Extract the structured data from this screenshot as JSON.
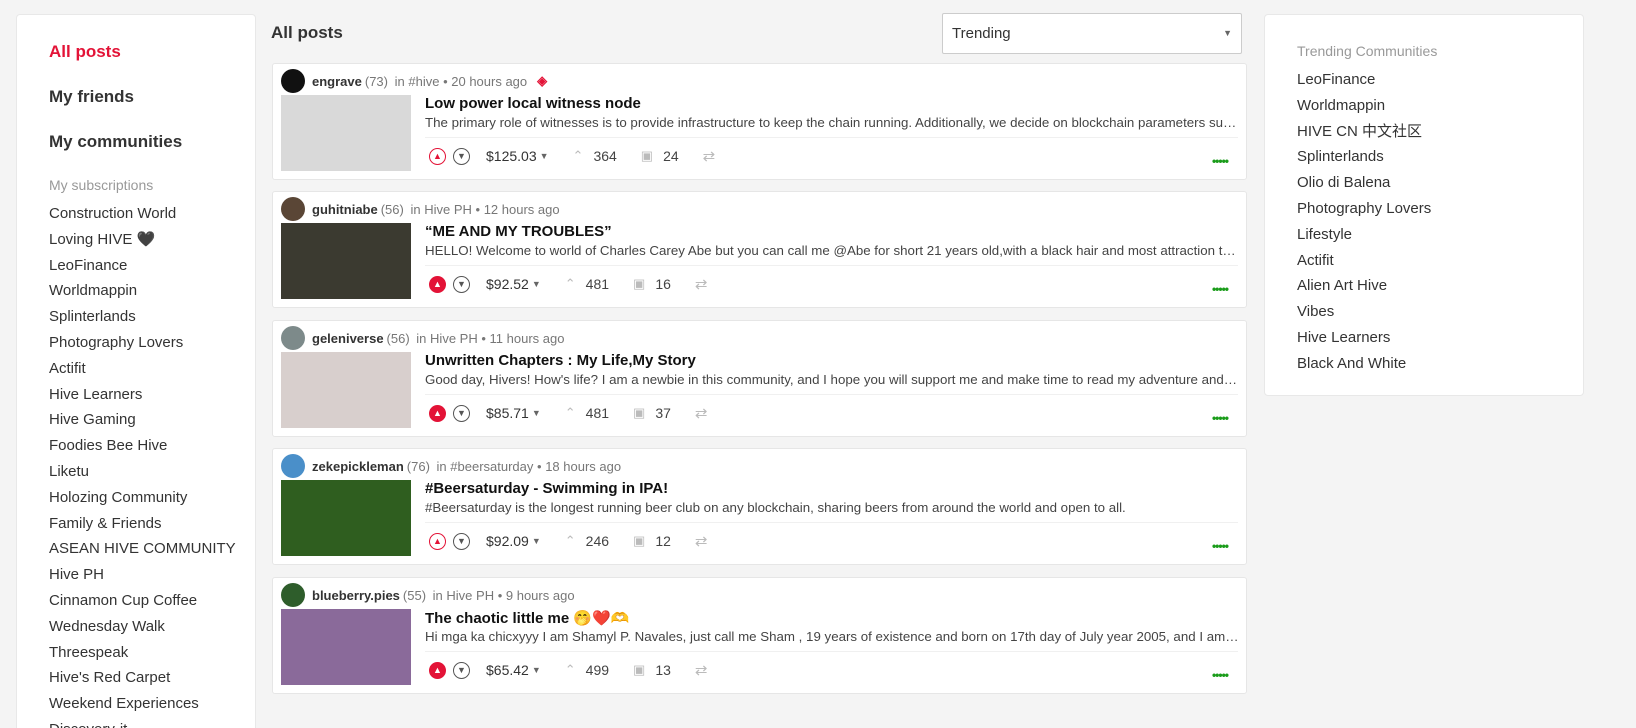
{
  "sidebar": {
    "nav": [
      "All posts",
      "My friends",
      "My communities"
    ],
    "subscriptions_heading": "My subscriptions",
    "subscriptions": [
      "Construction World",
      "Loving HIVE 🖤",
      "LeoFinance",
      "Worldmappin",
      "Splinterlands",
      "Photography Lovers",
      "Actifit",
      "Hive Learners",
      "Hive Gaming",
      "Foodies Bee Hive",
      "Liketu",
      "Holozing Community",
      "Family & Friends",
      "ASEAN HIVE COMMUNITY",
      "Hive PH",
      "Cinnamon Cup Coffee",
      "Wednesday Walk",
      "Threespeak",
      "Hive's Red Carpet",
      "Weekend Experiences",
      "Discovery-it"
    ]
  },
  "header": {
    "title": "All posts",
    "sort_value": "Trending"
  },
  "trending": {
    "heading": "Trending Communities",
    "items": [
      "LeoFinance",
      "Worldmappin",
      "HIVE CN 中文社区",
      "Splinterlands",
      "Olio di Balena",
      "Photography Lovers",
      "Lifestyle",
      "Actifit",
      "Alien Art Hive",
      "Vibes",
      "Hive Learners",
      "Black And White"
    ]
  },
  "posts": [
    {
      "author": "engrave",
      "rep": "(73)",
      "in": "in",
      "community": "#hive",
      "time": "• 20 hours ago",
      "title": "Low power local witness node",
      "summary": "The primary role of witnesses is to provide infrastructure to keep the chain running. Additionally, we decide on blockchain parameters such as interest rates and fees.",
      "payout": "$125.03",
      "votes": "364",
      "comments": "24",
      "voted": false,
      "avatar_color": "#111111",
      "thumb_color": "#d9d9d9"
    },
    {
      "author": "guhitniabe",
      "rep": "(56)",
      "in": "in",
      "community": "Hive PH",
      "time": "• 12 hours ago",
      "title": "“ME AND MY TROUBLES”",
      "summary": "HELLO! Welcome to world of Charles Carey Abe but you can call me @Abe for short 21 years old,with a black hair and most attraction to all.",
      "payout": "$92.52",
      "votes": "481",
      "comments": "16",
      "voted": true,
      "avatar_color": "#5a4636",
      "thumb_color": "#3b3a30"
    },
    {
      "author": "geleniverse",
      "rep": "(56)",
      "in": "in",
      "community": "Hive PH",
      "time": "• 11 hours ago",
      "title": "Unwritten Chapters : My Life,My Story",
      "summary": "Good day, Hivers! How's life? I am a newbie in this community, and I hope you will support me and make time to read my adventure and stories.",
      "payout": "$85.71",
      "votes": "481",
      "comments": "37",
      "voted": true,
      "avatar_color": "#7d8a8a",
      "thumb_color": "#d8cfcd"
    },
    {
      "author": "zekepickleman",
      "rep": "(76)",
      "in": "in",
      "community": "#beersaturday",
      "time": "• 18 hours ago",
      "title": "#Beersaturday - Swimming in IPA!",
      "summary": "#Beersaturday is the longest running beer club on any blockchain, sharing beers from around the world and open to all.",
      "payout": "$92.09",
      "votes": "246",
      "comments": "12",
      "voted": false,
      "avatar_color": "#4a8fc9",
      "thumb_color": "#2f5e1f"
    },
    {
      "author": "blueberry.pies",
      "rep": "(55)",
      "in": "in",
      "community": "Hive PH",
      "time": "• 9 hours ago",
      "title": "The chaotic little me 🤭❤️🫶",
      "summary": "Hi mga ka chicxyyy I am Shamyl P. Navales, just call me Sham , 19 years of existence and born on 17th day of July year 2005, and I am from the Philippines.",
      "payout": "$65.42",
      "votes": "499",
      "comments": "13",
      "voted": true,
      "avatar_color": "#2e5d2b",
      "thumb_color": "#8a6a9a"
    }
  ]
}
